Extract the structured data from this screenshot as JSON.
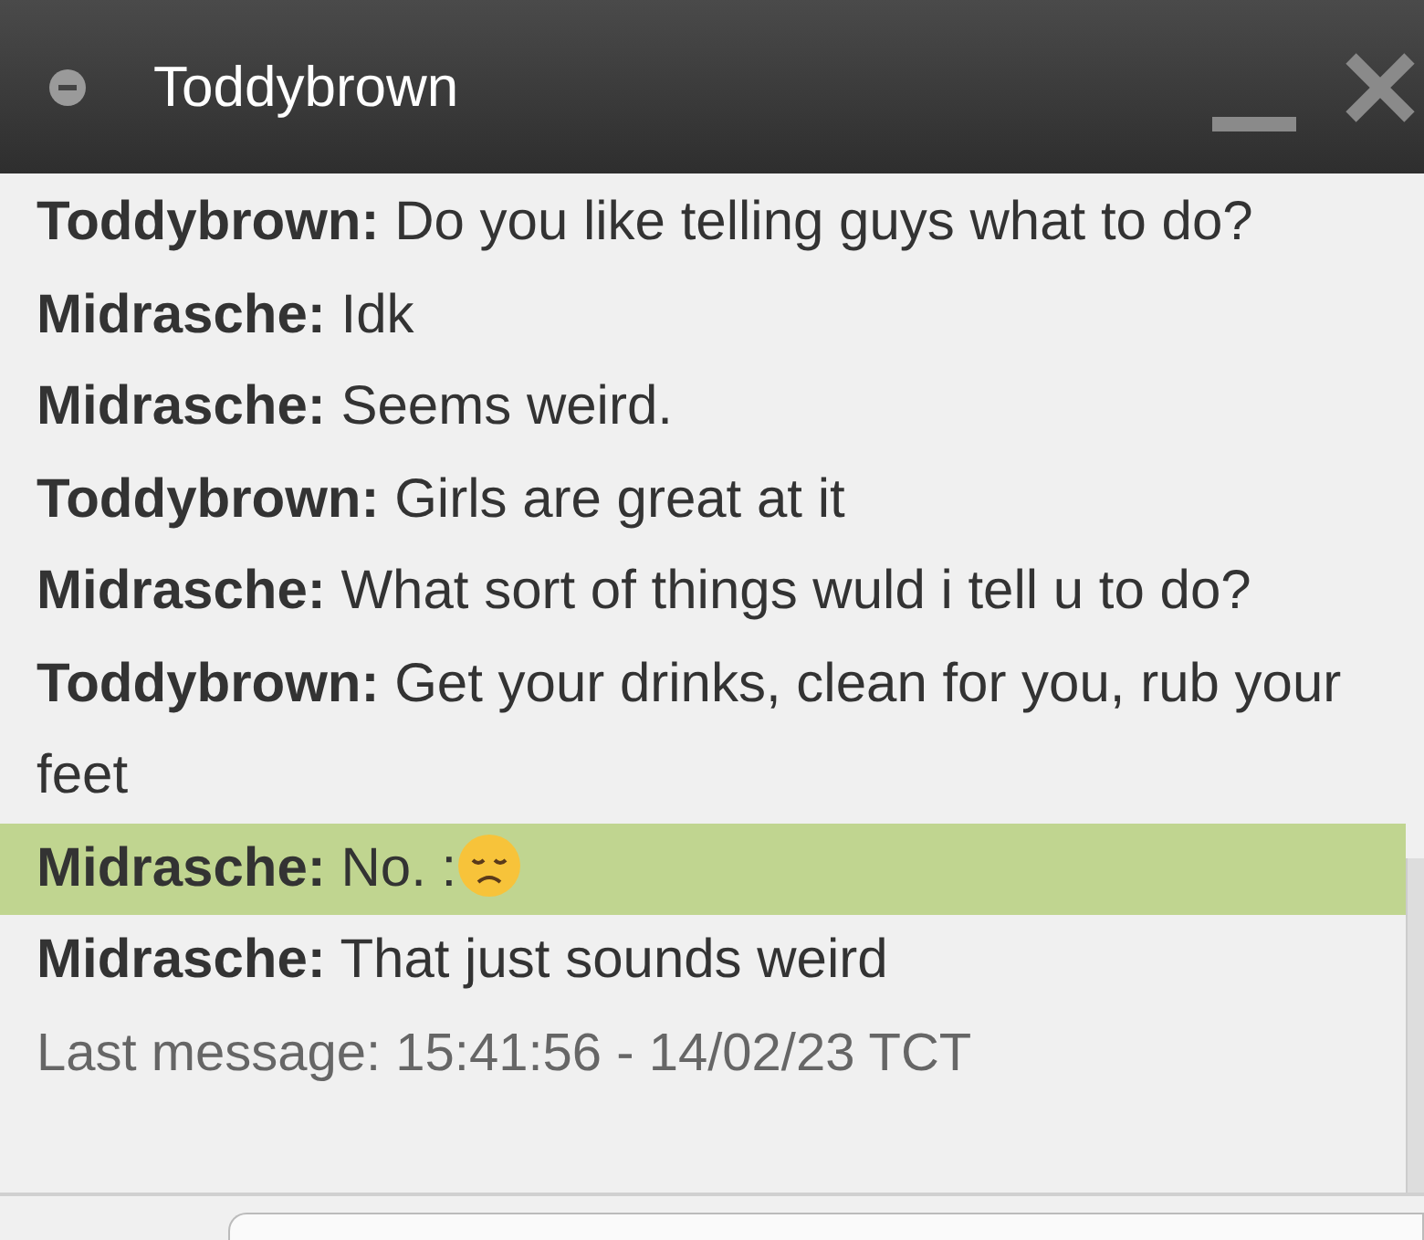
{
  "window": {
    "title": "Toddybrown"
  },
  "messages": [
    {
      "sender": "Toddybrown:",
      "text": "Do you like telling guys what to do?",
      "selected": false,
      "emoji": false
    },
    {
      "sender": "Midrasche:",
      "text": "Idk",
      "selected": false,
      "emoji": false
    },
    {
      "sender": "Midrasche:",
      "text": "Seems weird.",
      "selected": false,
      "emoji": false
    },
    {
      "sender": "Toddybrown:",
      "text": "Girls are great at it",
      "selected": false,
      "emoji": false
    },
    {
      "sender": "Midrasche:",
      "text": "What sort of things wuld i tell u to do?",
      "selected": false,
      "emoji": false
    },
    {
      "sender": "Toddybrown:",
      "text": "Get your drinks, clean for you, rub your feet",
      "selected": false,
      "emoji": false
    },
    {
      "sender": "Midrasche:",
      "text": "No. :",
      "selected": true,
      "emoji": true
    },
    {
      "sender": "Midrasche:",
      "text": "That just sounds weird",
      "selected": false,
      "emoji": false
    }
  ],
  "last_message": "Last message: 15:41:56 - 14/02/23 TCT"
}
